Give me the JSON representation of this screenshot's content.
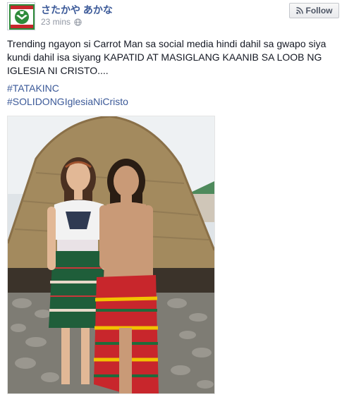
{
  "post": {
    "author": "さたかや あかな",
    "timestamp": "23 mins",
    "privacy_icon": "globe-icon",
    "follow_label": "Follow",
    "follow_icon": "rss-icon",
    "text": "Trending ngayon si Carrot Man sa social media hindi dahil sa gwapo siya kundi dahil isa siyang KAPATID AT MASIGLANG KAANIB SA LOOB NG IGLESIA NI CRISTO....",
    "hashtags": [
      "#TATAKINC",
      "#SOLIDONGIglesiaNiCristo"
    ]
  },
  "colors": {
    "link": "#3b5998",
    "meta": "#9197a3",
    "text": "#141823",
    "logo_green": "#2e8b3a",
    "logo_red": "#c8262c"
  }
}
